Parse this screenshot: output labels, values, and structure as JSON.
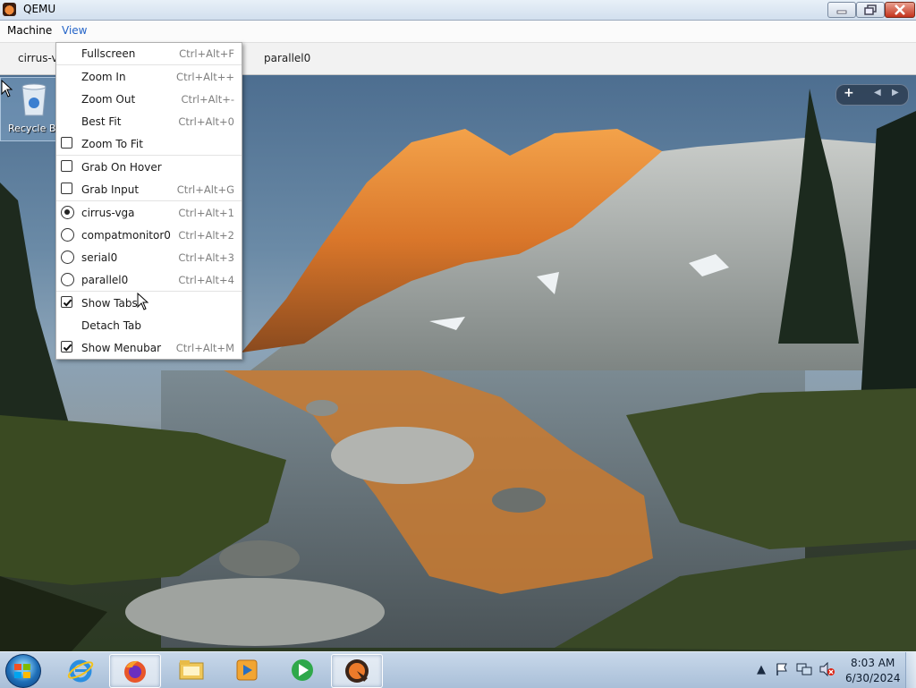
{
  "window": {
    "title": "QEMU",
    "buttons": {
      "minimize": "minimize",
      "maximize": "restore",
      "close": "close"
    }
  },
  "menubar": {
    "items": [
      "Machine",
      "View"
    ]
  },
  "tabs": {
    "visible": [
      "cirrus-vga",
      "parallel0"
    ],
    "active": "cirrus-vga"
  },
  "view_menu": {
    "items": [
      {
        "label": "Fullscreen",
        "shortcut": "Ctrl+Alt+F",
        "control": "none"
      },
      {
        "label": "Zoom In",
        "shortcut": "Ctrl+Alt++",
        "control": "none"
      },
      {
        "label": "Zoom Out",
        "shortcut": "Ctrl+Alt+-",
        "control": "none"
      },
      {
        "label": "Best Fit",
        "shortcut": "Ctrl+Alt+0",
        "control": "none"
      },
      {
        "label": "Zoom To Fit",
        "shortcut": "",
        "control": "checkbox",
        "checked": false
      },
      {
        "label": "Grab On Hover",
        "shortcut": "",
        "control": "checkbox",
        "checked": false
      },
      {
        "label": "Grab Input",
        "shortcut": "Ctrl+Alt+G",
        "control": "checkbox",
        "checked": false
      },
      {
        "label": "cirrus-vga",
        "shortcut": "Ctrl+Alt+1",
        "control": "radio",
        "checked": true
      },
      {
        "label": "compatmonitor0",
        "shortcut": "Ctrl+Alt+2",
        "control": "radio",
        "checked": false
      },
      {
        "label": "serial0",
        "shortcut": "Ctrl+Alt+3",
        "control": "radio",
        "checked": false
      },
      {
        "label": "parallel0",
        "shortcut": "Ctrl+Alt+4",
        "control": "radio",
        "checked": false
      },
      {
        "label": "Show Tabs",
        "shortcut": "",
        "control": "checkbox",
        "checked": true
      },
      {
        "label": "Detach Tab",
        "shortcut": "",
        "control": "none"
      },
      {
        "label": "Show Menubar",
        "shortcut": "Ctrl+Alt+M",
        "control": "checkbox",
        "checked": true
      }
    ]
  },
  "desktop": {
    "icons": [
      {
        "label": "Recycle Bi",
        "icon": "recycle-bin-icon"
      }
    ],
    "gadget_controls": [
      "add-gadget-icon",
      "previous-icon",
      "next-icon"
    ]
  },
  "taskbar": {
    "apps": [
      {
        "name": "internet-explorer-icon",
        "active": false
      },
      {
        "name": "firefox-icon",
        "active": true
      },
      {
        "name": "file-explorer-icon",
        "active": false
      },
      {
        "name": "media-player-icon",
        "active": false
      },
      {
        "name": "media-center-icon",
        "active": false
      },
      {
        "name": "qemu-icon",
        "active": true
      }
    ],
    "tray": [
      "show-hidden-icons-arrow",
      "action-center-flag-icon",
      "network-icon",
      "volume-muted-icon"
    ],
    "clock": {
      "time": "8:03 AM",
      "date": "6/30/2024"
    }
  },
  "colors": {
    "accent": "#2464c8",
    "close_button": "#c4331c"
  }
}
